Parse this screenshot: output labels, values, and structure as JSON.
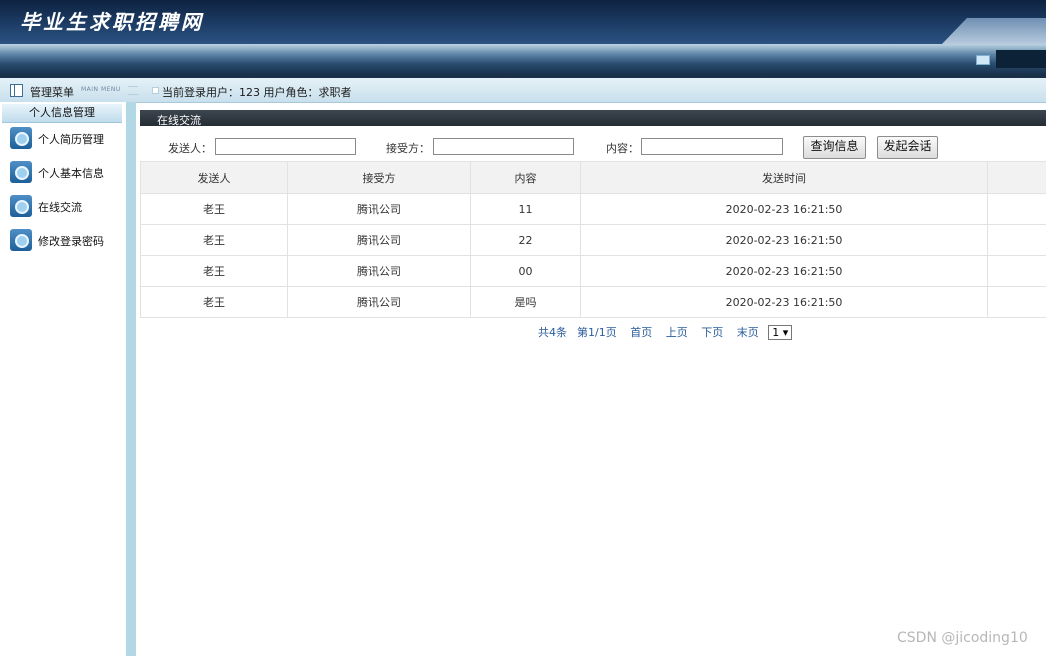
{
  "header": {
    "site_title": "毕业生求职招聘网"
  },
  "menubar": {
    "title": "管理菜单",
    "subtitle": "MAIN MENU",
    "status": "当前登录用户：123  用户角色：求职者"
  },
  "sidebar": {
    "group_title": "个人信息管理",
    "items": [
      {
        "label": "个人简历管理",
        "icon": "gear-icon"
      },
      {
        "label": "个人基本信息",
        "icon": "gear-icon"
      },
      {
        "label": "在线交流",
        "icon": "gear-icon"
      },
      {
        "label": "修改登录密码",
        "icon": "gear-icon"
      }
    ]
  },
  "panel": {
    "tab_label": "在线交流"
  },
  "filter": {
    "sender_label": "发送人：",
    "receiver_label": "接受方：",
    "content_label": "内容：",
    "sender_value": "",
    "receiver_value": "",
    "content_value": "",
    "query_button": "查询信息",
    "start_chat_button": "发起会话"
  },
  "table": {
    "columns": [
      "发送人",
      "接受方",
      "内容",
      "发送时间",
      ""
    ],
    "rows": [
      [
        "老王",
        "腾讯公司",
        "11",
        "2020-02-23 16:21:50",
        ""
      ],
      [
        "老王",
        "腾讯公司",
        "22",
        "2020-02-23 16:21:50",
        ""
      ],
      [
        "老王",
        "腾讯公司",
        "00",
        "2020-02-23 16:21:50",
        ""
      ],
      [
        "老王",
        "腾讯公司",
        "是吗",
        "2020-02-23 16:21:50",
        ""
      ]
    ]
  },
  "pager": {
    "total": "共4条",
    "page_info": "第1/1页",
    "first": "首页",
    "prev": "上页",
    "next": "下页",
    "last": "末页",
    "page_select": "1 ▾"
  },
  "watermark": "CSDN @jicoding10"
}
